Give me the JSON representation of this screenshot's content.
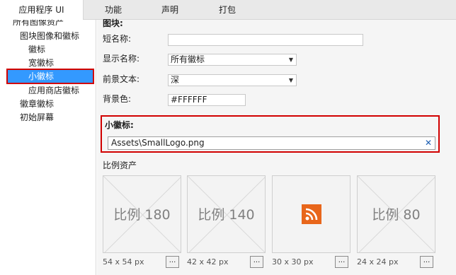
{
  "tabs": [
    {
      "label": "应用程序 UI"
    },
    {
      "label": "功能"
    },
    {
      "label": "声明"
    },
    {
      "label": "打包"
    }
  ],
  "nav": {
    "items": [
      {
        "label": "所有图像资产"
      },
      {
        "label": "图块图像和徽标"
      },
      {
        "label": "徽标"
      },
      {
        "label": "宽徽标"
      },
      {
        "label": "小徽标"
      },
      {
        "label": "应用商店徽标"
      },
      {
        "label": "徽章徽标"
      },
      {
        "label": "初始屏幕"
      }
    ]
  },
  "tile_section": {
    "header": "图块:",
    "short_name": {
      "label": "短名称:",
      "value": ""
    },
    "display_name": {
      "label": "显示名称:",
      "value": "所有徽标"
    },
    "foreground_text": {
      "label": "前景文本:",
      "value": "深"
    },
    "background_color": {
      "label": "背景色:",
      "value": "#FFFFFF"
    }
  },
  "small_logo": {
    "label": "小徽标:",
    "path": "Assets\\SmallLogo.png",
    "clear": "✕"
  },
  "scale_assets": {
    "header": "比例资产",
    "tiles": [
      {
        "label": "比例 180",
        "size": "54 x 54 px",
        "button": "..."
      },
      {
        "label": "比例 140",
        "size": "42 x 42 px",
        "button": "..."
      },
      {
        "label": "",
        "size": "30 x 30 px",
        "button": "...",
        "icon": "rss-icon"
      },
      {
        "label": "比例 80",
        "size": "24 x 24 px",
        "button": "..."
      }
    ]
  },
  "colors": {
    "highlight_red": "#d10000",
    "selection_blue": "#3399ff",
    "rss_orange": "#e8661b"
  }
}
